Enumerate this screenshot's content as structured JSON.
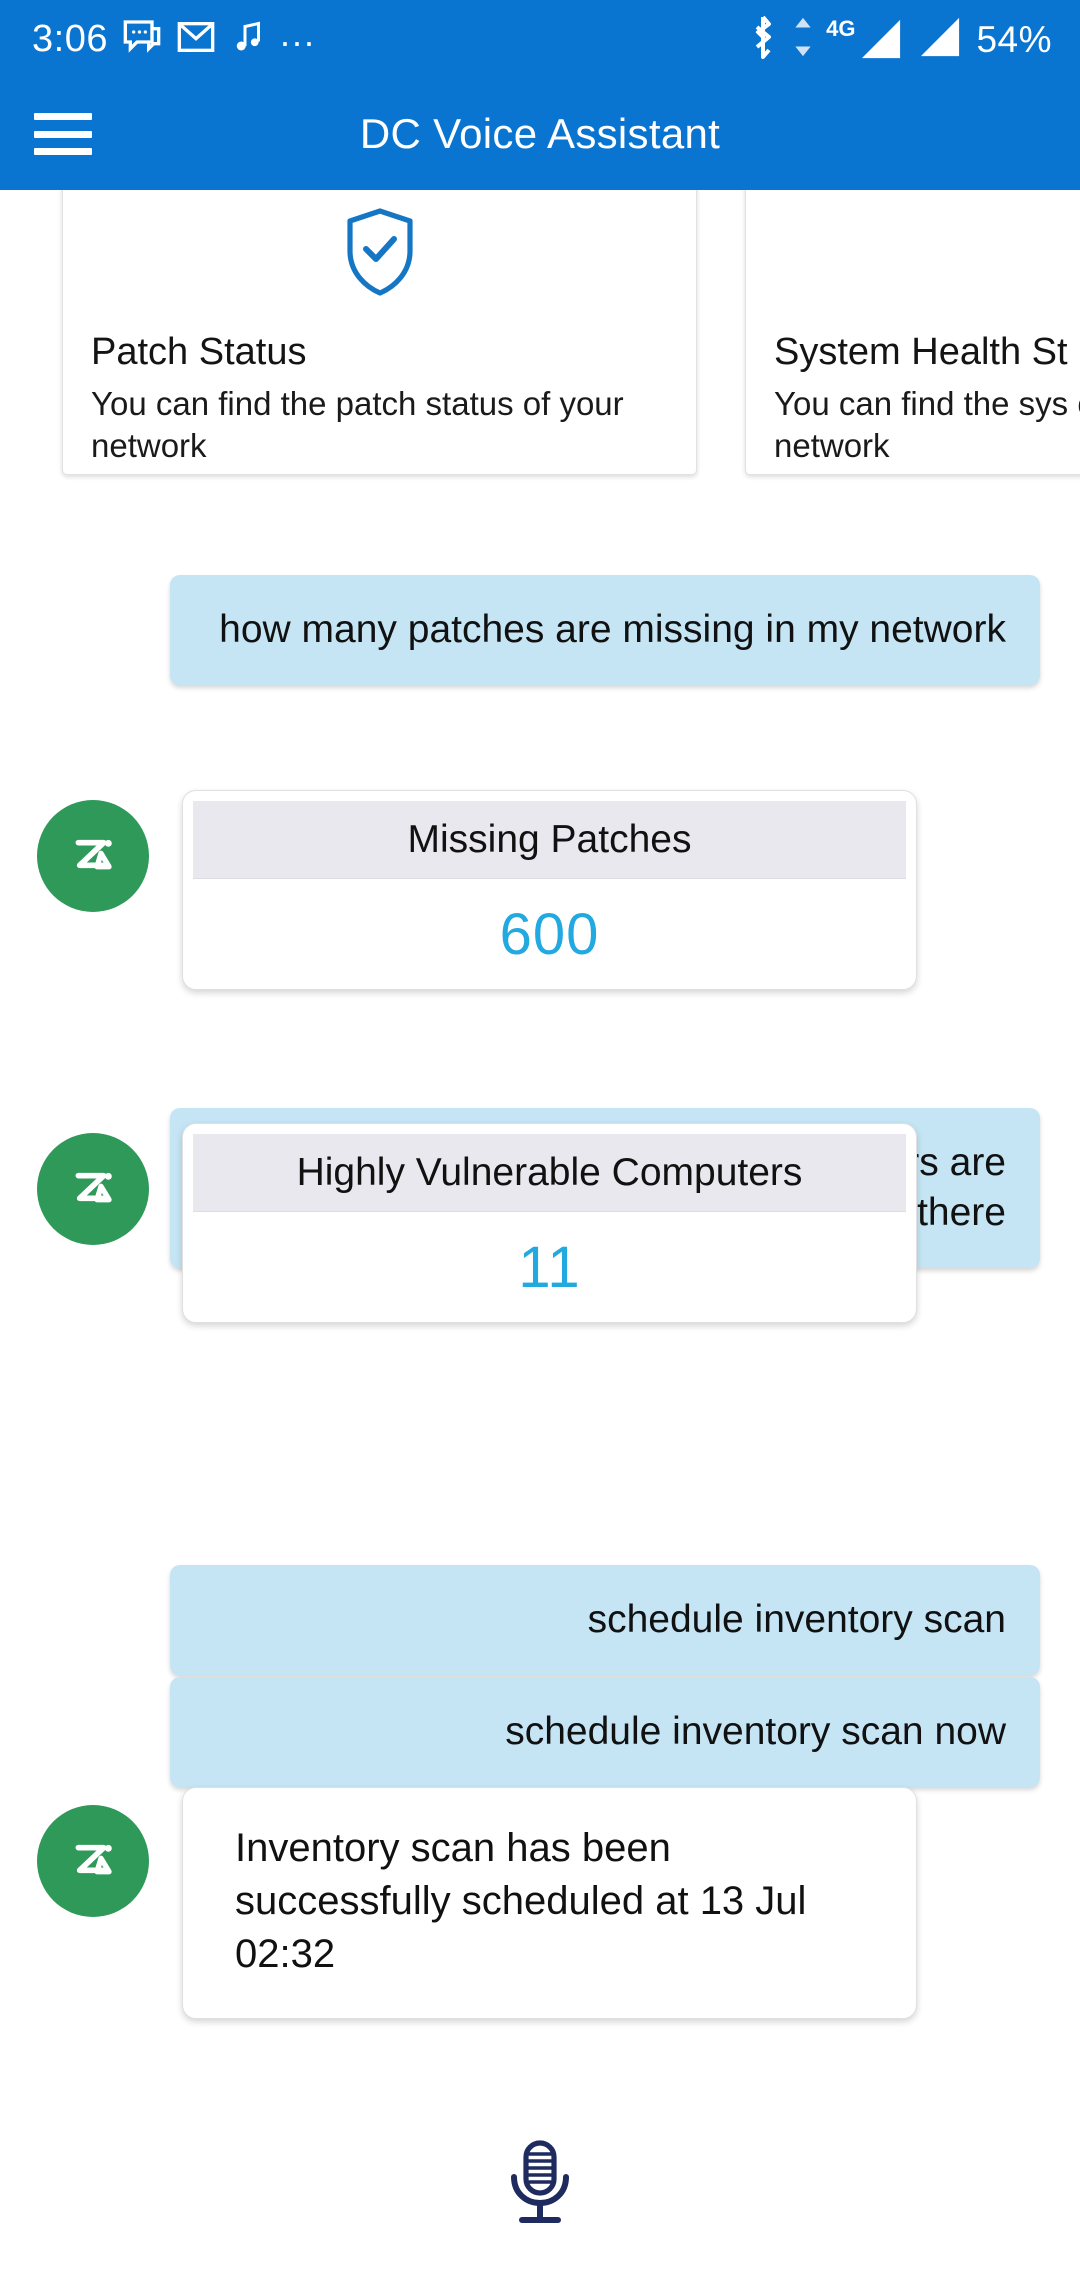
{
  "status_bar": {
    "clock": "3:06",
    "battery": "54%",
    "network_label": "4G",
    "overflow_dots": "...",
    "icons": [
      "sms-icon",
      "gmail-icon",
      "music-note-icon",
      "overflow-dots-icon",
      "bluetooth-icon",
      "data-transfer-icon",
      "signal-4g-icon",
      "signal-icon"
    ]
  },
  "app_bar": {
    "title": "DC Voice Assistant",
    "menu_icon": "hamburger-menu-icon"
  },
  "suggestion_cards": [
    {
      "icon": "shield-check-icon",
      "title": "Patch Status",
      "description": "You can find the patch status of your network"
    },
    {
      "icon": "shield-check-icon",
      "title": "System Health St",
      "description": "You can find the sys of your network"
    }
  ],
  "conversation": [
    {
      "type": "user",
      "text": "how many patches are missing in my network"
    },
    {
      "type": "bot_metric",
      "avatar": "zia-avatar",
      "header": "Missing Patches",
      "value": "600"
    },
    {
      "type": "user",
      "text": "how many highly vulnerable computers are there"
    },
    {
      "type": "bot_metric",
      "avatar": "zia-avatar",
      "header": "Highly Vulnerable Computers",
      "value": "11"
    },
    {
      "type": "user",
      "text": "schedule inventory scan"
    },
    {
      "type": "user",
      "text": "schedule inventory scan now"
    },
    {
      "type": "bot_text",
      "avatar": "zia-avatar",
      "text": "Inventory scan has been successfully scheduled at 13 Jul 02:32"
    }
  ],
  "footer": {
    "mic_icon": "microphone-icon"
  },
  "colors": {
    "app_bar": "#0a74d1",
    "user_bubble": "#c5e5f5",
    "avatar_green": "#2e9959",
    "metric_value": "#22a9e0",
    "card_header": "#e8e8ee",
    "mic": "#1f2a5e"
  }
}
